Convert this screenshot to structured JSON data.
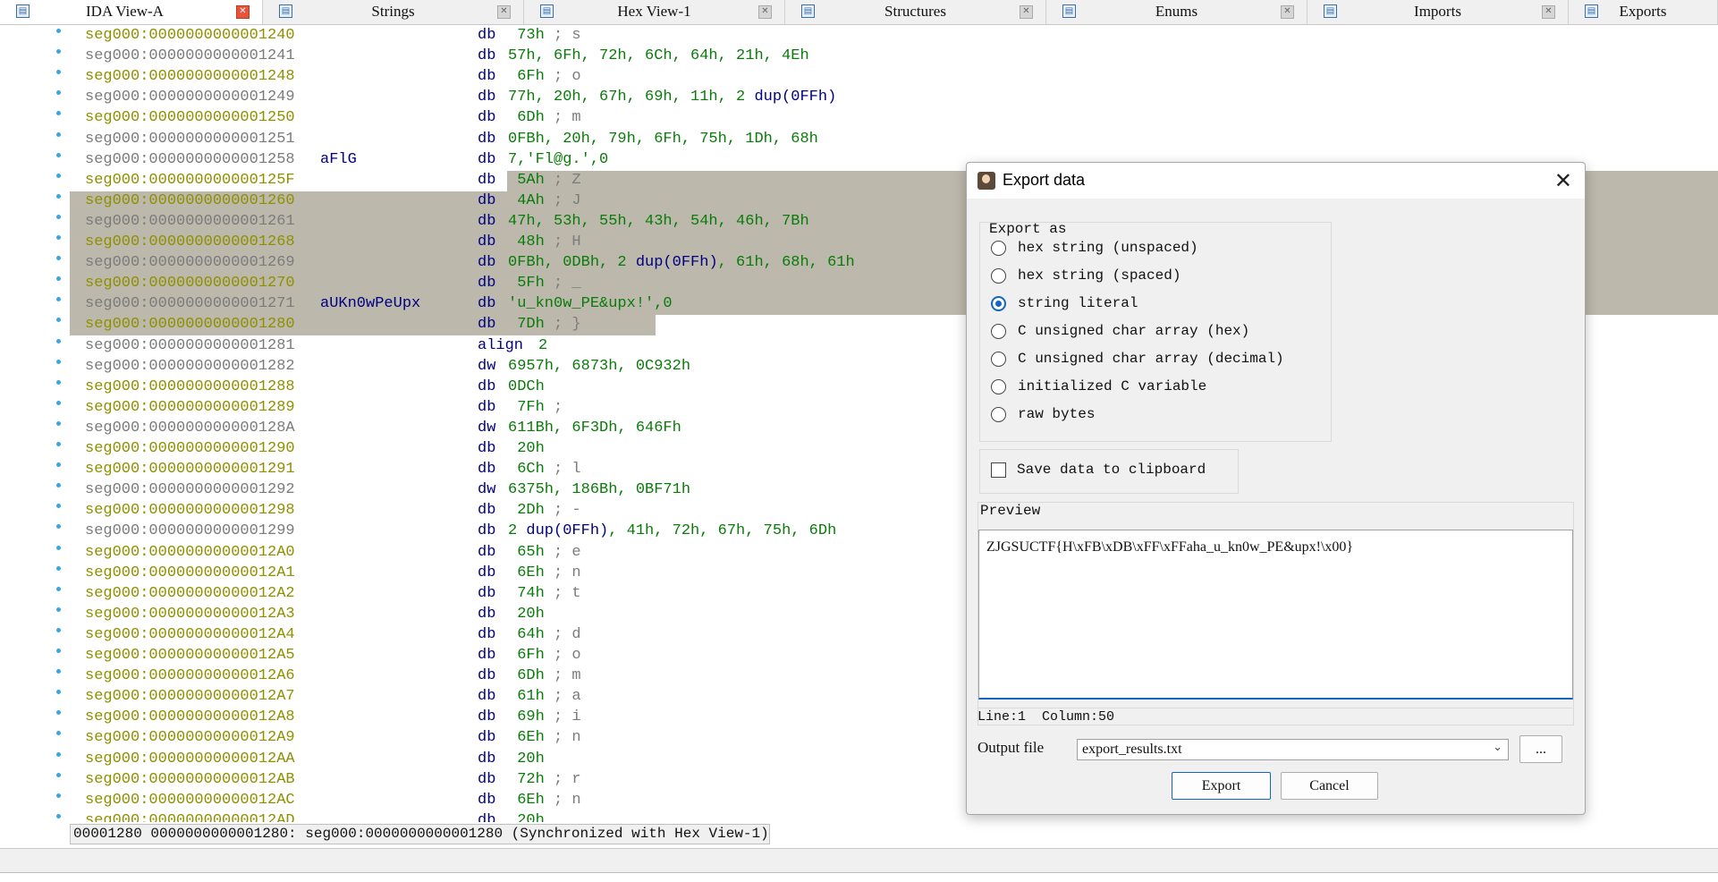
{
  "tabs": [
    {
      "label": "IDA View-A",
      "active": true,
      "icon": "ida-view-icon"
    },
    {
      "label": "Strings",
      "icon": "strings-icon"
    },
    {
      "label": "Hex View-1",
      "icon": "hex-view-icon"
    },
    {
      "label": "Structures",
      "icon": "structures-icon"
    },
    {
      "label": "Enums",
      "icon": "enums-icon"
    },
    {
      "label": "Imports",
      "icon": "imports-icon"
    },
    {
      "label": "Exports",
      "icon": "exports-icon"
    }
  ],
  "listing": [
    {
      "addr": "seg000:0000000000001240",
      "label": "",
      "mn": "db",
      "ops": " 73h",
      "cmt": " ; s",
      "grey": false
    },
    {
      "addr": "seg000:0000000000001241",
      "label": "",
      "mn": "db",
      "ops": "57h, 6Fh, 72h, 6Ch, 64h, 21h, 4Eh",
      "cmt": "",
      "grey": true
    },
    {
      "addr": "seg000:0000000000001248",
      "label": "",
      "mn": "db",
      "ops": " 6Fh",
      "cmt": " ; o",
      "grey": false
    },
    {
      "addr": "seg000:0000000000001249",
      "label": "",
      "mn": "db",
      "ops": "77h, 20h, 67h, 69h, 11h, 2 ",
      "kw": "dup(0FFh)",
      "cmt": "",
      "grey": true
    },
    {
      "addr": "seg000:0000000000001250",
      "label": "",
      "mn": "db",
      "ops": " 6Dh",
      "cmt": " ; m",
      "grey": false
    },
    {
      "addr": "seg000:0000000000001251",
      "label": "",
      "mn": "db",
      "ops": "0FBh, 20h, 79h, 6Fh, 75h, 1Dh, 68h",
      "cmt": "",
      "grey": true
    },
    {
      "addr": "seg000:0000000000001258",
      "label": "aFlG",
      "mn": "db",
      "ops": "7,'Fl@g.',0",
      "cmt": "",
      "grey": true
    },
    {
      "addr": "seg000:000000000000125F",
      "label": "",
      "mn": "db",
      "ops": " 5Ah",
      "cmt": " ; Z",
      "grey": false,
      "sel": "partial"
    },
    {
      "addr": "seg000:0000000000001260",
      "label": "",
      "mn": "db",
      "ops": " 4Ah",
      "cmt": " ; J",
      "grey": false,
      "sel": "full"
    },
    {
      "addr": "seg000:0000000000001261",
      "label": "",
      "mn": "db",
      "ops": "47h, 53h, 55h, 43h, 54h, 46h, 7Bh",
      "cmt": "",
      "grey": true,
      "sel": "full"
    },
    {
      "addr": "seg000:0000000000001268",
      "label": "",
      "mn": "db",
      "ops": " 48h",
      "cmt": " ; H",
      "grey": false,
      "sel": "full"
    },
    {
      "addr": "seg000:0000000000001269",
      "label": "",
      "mn": "db",
      "ops": "0FBh, 0DBh, 2 ",
      "kw": "dup(0FFh)",
      "tail": ", 61h, 68h, 61h",
      "cmt": "",
      "grey": true,
      "sel": "full"
    },
    {
      "addr": "seg000:0000000000001270",
      "label": "",
      "mn": "db",
      "ops": " 5Fh",
      "cmt": " ; _",
      "grey": false,
      "sel": "full"
    },
    {
      "addr": "seg000:0000000000001271",
      "label": "aUKn0wPeUpx",
      "mn": "db",
      "ops": "'u_kn0w_PE&upx!',0",
      "cmt": "",
      "grey": true,
      "sel": "full"
    },
    {
      "addr": "seg000:0000000000001280",
      "label": "",
      "mn": "db",
      "ops": " 7Dh",
      "cmt": " ; }",
      "grey": false,
      "sel": "last"
    },
    {
      "addr": "seg000:0000000000001281",
      "label": "",
      "mn": "align",
      "ops": "2",
      "cmt": "",
      "grey": true,
      "mnkw": true
    },
    {
      "addr": "seg000:0000000000001282",
      "label": "",
      "mn": "dw",
      "ops": "6957h, 6873h, 0C932h",
      "cmt": "",
      "grey": true
    },
    {
      "addr": "seg000:0000000000001288",
      "label": "",
      "mn": "db",
      "ops": "0DCh",
      "cmt": "",
      "grey": false
    },
    {
      "addr": "seg000:0000000000001289",
      "label": "",
      "mn": "db",
      "ops": " 7Fh",
      "cmt": " ;",
      "grey": false
    },
    {
      "addr": "seg000:000000000000128A",
      "label": "",
      "mn": "dw",
      "ops": "611Bh, 6F3Dh, 646Fh",
      "cmt": "",
      "grey": true
    },
    {
      "addr": "seg000:0000000000001290",
      "label": "",
      "mn": "db",
      "ops": " 20h",
      "cmt": "",
      "grey": false
    },
    {
      "addr": "seg000:0000000000001291",
      "label": "",
      "mn": "db",
      "ops": " 6Ch",
      "cmt": " ; l",
      "grey": false
    },
    {
      "addr": "seg000:0000000000001292",
      "label": "",
      "mn": "dw",
      "ops": "6375h, 186Bh, 0BF71h",
      "cmt": "",
      "grey": true
    },
    {
      "addr": "seg000:0000000000001298",
      "label": "",
      "mn": "db",
      "ops": " 2Dh",
      "cmt": " ; -",
      "grey": false
    },
    {
      "addr": "seg000:0000000000001299",
      "label": "",
      "mn": "db",
      "ops": "2 ",
      "kw": "dup(0FFh)",
      "tail": ", 41h, 72h, 67h, 75h, 6Dh",
      "cmt": "",
      "grey": true
    },
    {
      "addr": "seg000:00000000000012A0",
      "label": "",
      "mn": "db",
      "ops": " 65h",
      "cmt": " ; e",
      "grey": false
    },
    {
      "addr": "seg000:00000000000012A1",
      "label": "",
      "mn": "db",
      "ops": " 6Eh",
      "cmt": " ; n",
      "grey": false
    },
    {
      "addr": "seg000:00000000000012A2",
      "label": "",
      "mn": "db",
      "ops": " 74h",
      "cmt": " ; t",
      "grey": false
    },
    {
      "addr": "seg000:00000000000012A3",
      "label": "",
      "mn": "db",
      "ops": " 20h",
      "cmt": "",
      "grey": false
    },
    {
      "addr": "seg000:00000000000012A4",
      "label": "",
      "mn": "db",
      "ops": " 64h",
      "cmt": " ; d",
      "grey": false
    },
    {
      "addr": "seg000:00000000000012A5",
      "label": "",
      "mn": "db",
      "ops": " 6Fh",
      "cmt": " ; o",
      "grey": false
    },
    {
      "addr": "seg000:00000000000012A6",
      "label": "",
      "mn": "db",
      "ops": " 6Dh",
      "cmt": " ; m",
      "grey": false
    },
    {
      "addr": "seg000:00000000000012A7",
      "label": "",
      "mn": "db",
      "ops": " 61h",
      "cmt": " ; a",
      "grey": false
    },
    {
      "addr": "seg000:00000000000012A8",
      "label": "",
      "mn": "db",
      "ops": " 69h",
      "cmt": " ; i",
      "grey": false
    },
    {
      "addr": "seg000:00000000000012A9",
      "label": "",
      "mn": "db",
      "ops": " 6Eh",
      "cmt": " ; n",
      "grey": false
    },
    {
      "addr": "seg000:00000000000012AA",
      "label": "",
      "mn": "db",
      "ops": " 20h",
      "cmt": "",
      "grey": false
    },
    {
      "addr": "seg000:00000000000012AB",
      "label": "",
      "mn": "db",
      "ops": " 72h",
      "cmt": " ; r",
      "grey": false
    },
    {
      "addr": "seg000:00000000000012AC",
      "label": "",
      "mn": "db",
      "ops": " 6Eh",
      "cmt": " ; n",
      "grey": false
    },
    {
      "addr": "seg000:00000000000012AD",
      "label": "",
      "mn": "db",
      "ops": " 20h",
      "cmt": "",
      "grey": false
    }
  ],
  "status_bar": "00001280 0000000000001280: seg000:0000000000001280 (Synchronized with Hex View-1)",
  "dialog": {
    "title": "Export data",
    "export_as_title": "Export as",
    "options": [
      {
        "label": "hex string (unspaced)",
        "checked": false
      },
      {
        "label": "hex string (spaced)",
        "checked": false
      },
      {
        "label": "string literal",
        "checked": true
      },
      {
        "label": "C unsigned char array (hex)",
        "checked": false
      },
      {
        "label": "C unsigned char array (decimal)",
        "checked": false
      },
      {
        "label": "initialized C variable",
        "checked": false
      },
      {
        "label": "raw bytes",
        "checked": false
      }
    ],
    "clipboard_label": "Save data to clipboard",
    "clipboard_checked": false,
    "preview_title": "Preview",
    "preview_text": "ZJGSUCTF{H\\xFB\\xDB\\xFF\\xFFaha_u_kn0w_PE&upx!\\x00}",
    "cursor_info": "Line:1  Column:50",
    "output_label": "Output file",
    "output_value": "export_results.txt",
    "browse_label": "...",
    "export_label": "Export",
    "cancel_label": "Cancel"
  },
  "colors": {
    "selection": "#bcb9ac",
    "address_yellow": "#8f8f00",
    "address_grey": "#7b7b7b",
    "mnemonic": "#000080",
    "operand": "#0a7b0a",
    "accent": "#1565c0"
  }
}
